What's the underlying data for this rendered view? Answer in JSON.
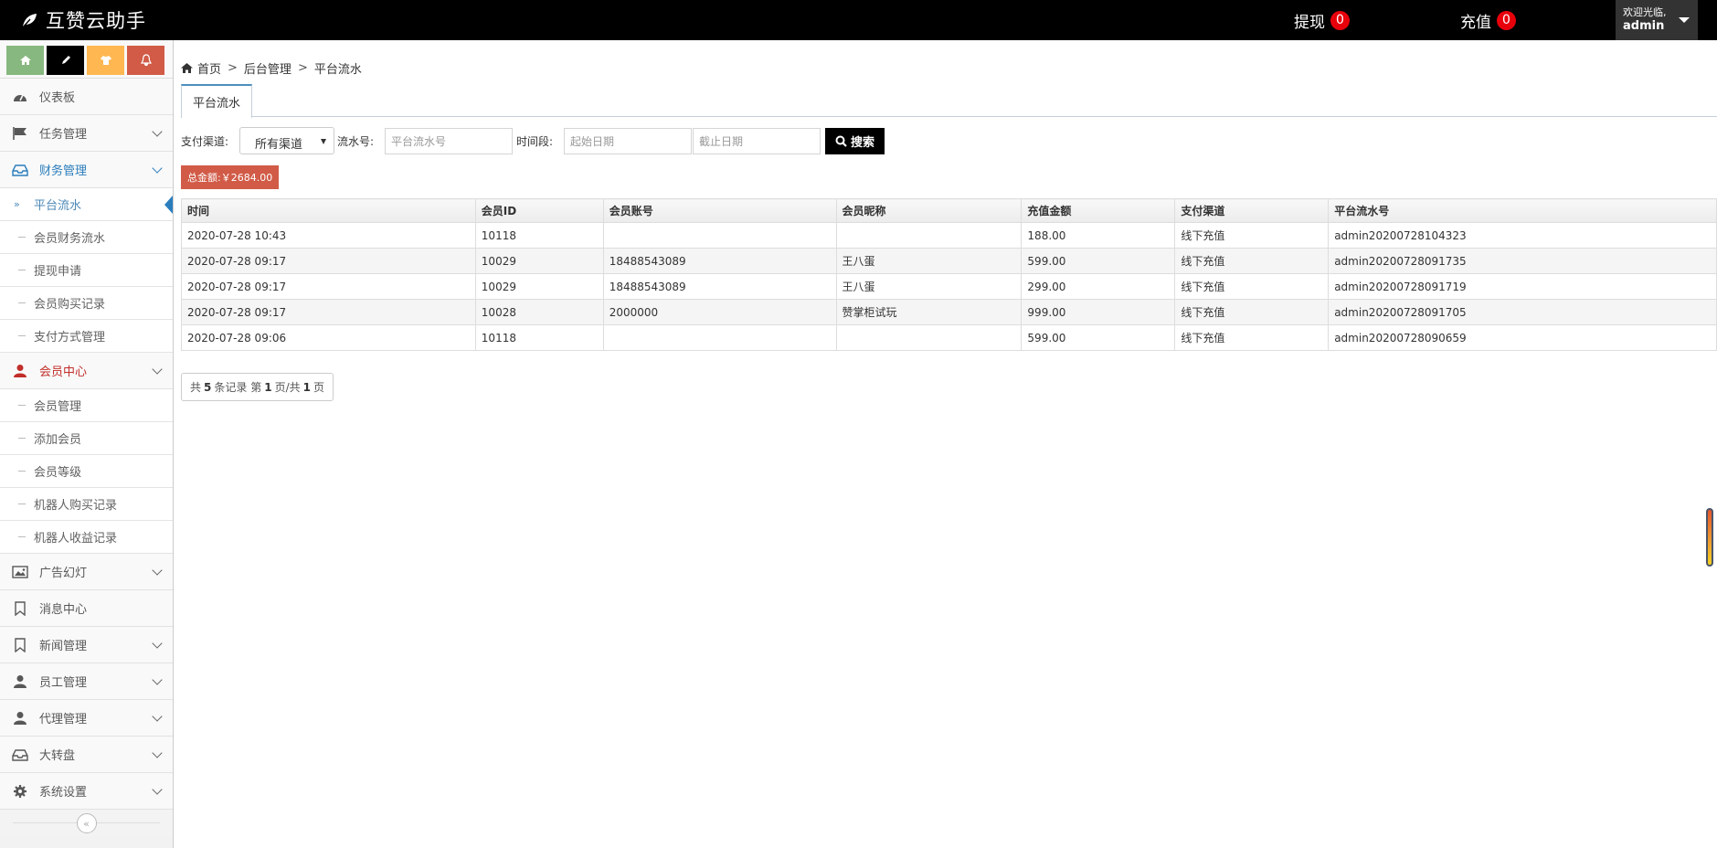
{
  "app": {
    "title": "互赞云助手",
    "withdraw_label": "提现",
    "withdraw_count": "0",
    "recharge_label": "充值",
    "recharge_count": "0",
    "welcome": "欢迎光临,",
    "username": "admin"
  },
  "sidebar": {
    "quick_buttons": [
      {
        "icon": "home-icon",
        "color": "#87b87f"
      },
      {
        "icon": "pencil-icon",
        "color": "#000000"
      },
      {
        "icon": "shirt-icon",
        "color": "#ffb752"
      },
      {
        "icon": "bell-icon",
        "color": "#d15b47"
      }
    ],
    "dashboard": "仪表板",
    "task": "任务管理",
    "finance": "财务管理",
    "finance_items": [
      "平台流水",
      "会员财务流水",
      "提现申请",
      "会员购买记录",
      "支付方式管理"
    ],
    "member": "会员中心",
    "member_items": [
      "会员管理",
      "添加会员",
      "会员等级",
      "机器人购买记录",
      "机器人收益记录"
    ],
    "ads": "广告幻灯",
    "messages": "消息中心",
    "news": "新闻管理",
    "staff": "员工管理",
    "agent": "代理管理",
    "wheel": "大转盘",
    "settings": "系统设置",
    "current_marker": "»"
  },
  "breadcrumb": {
    "home": "首页",
    "sep": ">",
    "section": "后台管理",
    "current": "平台流水"
  },
  "tabs": [
    "平台流水"
  ],
  "filters": {
    "channel_label": "支付渠道:",
    "channel_value": "所有渠道",
    "serial_label": "流水号:",
    "serial_placeholder": "平台流水号",
    "period_label": "时间段:",
    "start_placeholder": "起始日期",
    "end_placeholder": "截止日期",
    "search_label": "搜索"
  },
  "total": "总金额:￥2684.00",
  "table": {
    "columns": [
      "时间",
      "会员ID",
      "会员账号",
      "会员昵称",
      "充值金额",
      "支付渠道",
      "平台流水号"
    ],
    "rows": [
      [
        "2020-07-28 10:43",
        "10118",
        "",
        "",
        "188.00",
        "线下充值",
        "admin20200728104323"
      ],
      [
        "2020-07-28 09:17",
        "10029",
        "18488543089",
        "王八蛋",
        "599.00",
        "线下充值",
        "admin20200728091735"
      ],
      [
        "2020-07-28 09:17",
        "10029",
        "18488543089",
        "王八蛋",
        "299.00",
        "线下充值",
        "admin20200728091719"
      ],
      [
        "2020-07-28 09:17",
        "10028",
        "2000000",
        "赞掌柜试玩",
        "999.00",
        "线下充值",
        "admin20200728091705"
      ],
      [
        "2020-07-28 09:06",
        "10118",
        "",
        "",
        "599.00",
        "线下充值",
        "admin20200728090659"
      ]
    ]
  },
  "pager": {
    "prefix": "共",
    "total_records": "5",
    "mid1": "条记录 第",
    "current_page": "1",
    "mid2": "页/共",
    "total_pages": "1",
    "suffix": "页"
  }
}
